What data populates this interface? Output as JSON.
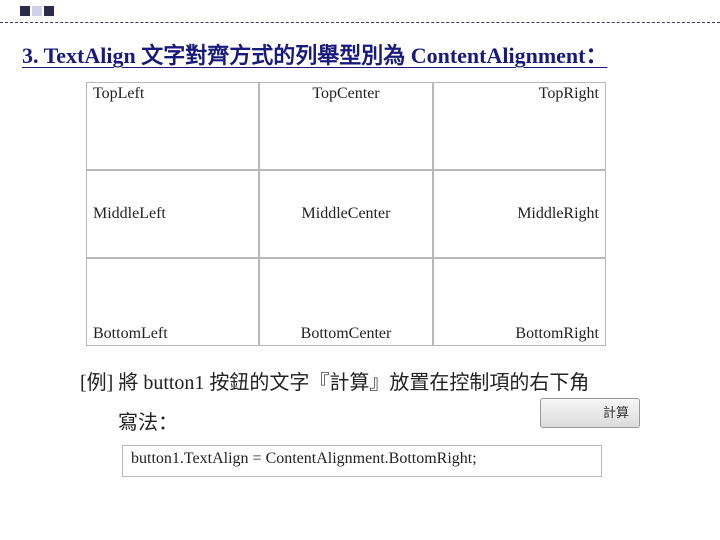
{
  "heading": "3. TextAlign 文字對齊方式的列舉型別為 ContentAlignment：",
  "grid": {
    "cells": [
      {
        "label": "TopLeft",
        "pos": "tl"
      },
      {
        "label": "TopCenter",
        "pos": "tc"
      },
      {
        "label": "TopRight",
        "pos": "tr"
      },
      {
        "label": "MiddleLeft",
        "pos": "ml"
      },
      {
        "label": "MiddleCenter",
        "pos": "mc"
      },
      {
        "label": "MiddleRight",
        "pos": "mr"
      },
      {
        "label": "BottomLeft",
        "pos": "bl"
      },
      {
        "label": "BottomCenter",
        "pos": "bc"
      },
      {
        "label": "BottomRight",
        "pos": "br"
      }
    ]
  },
  "example": {
    "line1": "[例] 將 button1 按鈕的文字『計算』放置在控制項的右下角",
    "line2": "寫法："
  },
  "button": {
    "label": "計算"
  },
  "code": "button1.TextAlign = ContentAlignment.BottomRight;"
}
